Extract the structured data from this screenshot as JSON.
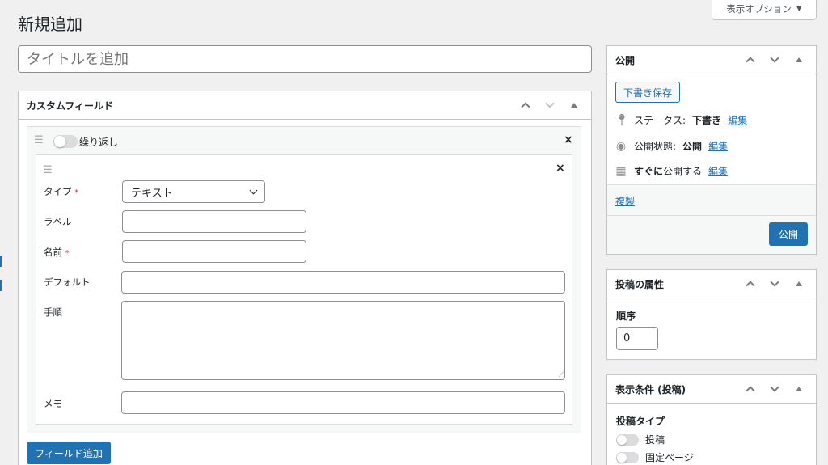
{
  "page": {
    "title": "新規追加"
  },
  "screen_options": {
    "label": "表示オプション",
    "arrow": "▼"
  },
  "title_field": {
    "placeholder": "タイトルを追加"
  },
  "custom_fields": {
    "title": "カスタムフィールド",
    "repeat_label": "繰り返し",
    "fields": {
      "type_label": "タイプ",
      "type_value": "テキスト",
      "label_label": "ラベル",
      "name_label": "名前",
      "default_label": "デフォルト",
      "instructions_label": "手順",
      "memo_label": "メモ",
      "required_mark": "*"
    },
    "add_button": "フィールド追加"
  },
  "publish": {
    "title": "公開",
    "save_draft": "下書き保存",
    "status_label": "ステータス:",
    "status_value": "下書き",
    "visibility_label": "公開状態:",
    "visibility_value": "公開",
    "schedule_bold": "すぐに",
    "schedule_rest": "公開する",
    "edit": "編集",
    "duplicate": "複製",
    "publish_button": "公開"
  },
  "attributes": {
    "title": "投稿の属性",
    "order_label": "順序",
    "order_value": "0"
  },
  "display_conditions": {
    "title": "表示条件 (投稿)",
    "post_type_label": "投稿タイプ",
    "options": [
      "投稿",
      "固定ページ"
    ]
  },
  "colors": {
    "accent": "#2271b1",
    "required": "#d63638"
  }
}
